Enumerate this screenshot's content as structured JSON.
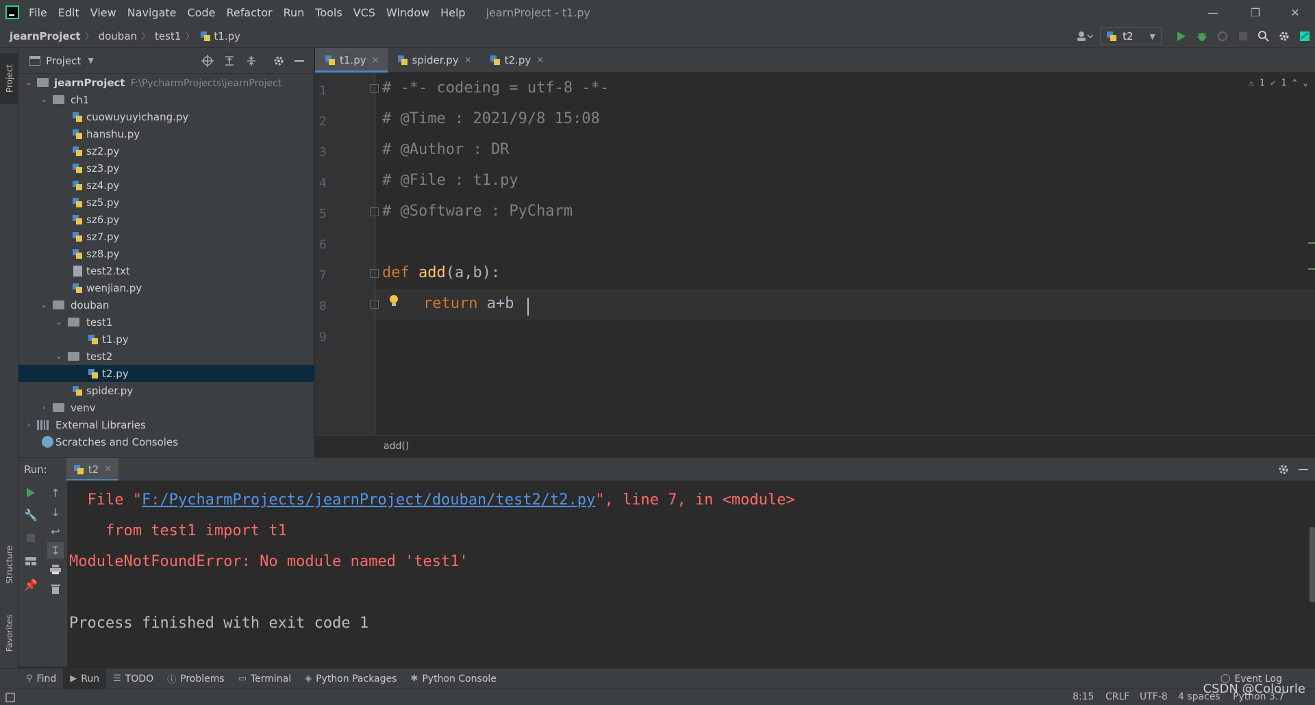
{
  "menu": {
    "items": [
      "File",
      "Edit",
      "View",
      "Navigate",
      "Code",
      "Refactor",
      "Run",
      "Tools",
      "VCS",
      "Window",
      "Help"
    ],
    "window_title": "jearnProject - t1.py"
  },
  "navbar": {
    "crumbs": [
      "jearnProject",
      "douban",
      "test1",
      "t1.py"
    ],
    "run_config": "t2"
  },
  "left_strip": {
    "project": "Project",
    "structure": "Structure",
    "favorites": "Favorites"
  },
  "project_panel": {
    "title": "Project",
    "root_name": "jearnProject",
    "root_path": "F:\\PycharmProjects\\jearnProject",
    "ch1": "ch1",
    "ch1_files": [
      "cuowuyuyichang.py",
      "hanshu.py",
      "sz2.py",
      "sz3.py",
      "sz4.py",
      "sz5.py",
      "sz6.py",
      "sz7.py",
      "sz8.py",
      "test2.txt",
      "wenjian.py"
    ],
    "douban": "douban",
    "test1": "test1",
    "t1": "t1.py",
    "test2": "test2",
    "t2": "t2.py",
    "spider": "spider.py",
    "venv": "venv",
    "ext_libs": "External Libraries",
    "scratches": "Scratches and Consoles"
  },
  "editor": {
    "tabs": [
      "t1.py",
      "spider.py",
      "t2.py"
    ],
    "line_numbers": [
      "1",
      "2",
      "3",
      "4",
      "5",
      "6",
      "7",
      "8",
      "9"
    ],
    "lines": {
      "l1": "# -*- codeing = utf-8 -*-",
      "l2": "# @Time : 2021/9/8 15:08",
      "l3": "# @Author : DR",
      "l4": "# @File : t1.py",
      "l5": "# @Software : PyCharm",
      "l7_kw": "def",
      "l7_fn": "add",
      "l7_rest": "(a,b):",
      "l8_kw": "return",
      "l8_rest": "a+b"
    },
    "warnings": "1",
    "weak_warnings": "1",
    "breadcrumb": "add()"
  },
  "run": {
    "label": "Run:",
    "tab": "t2",
    "console": {
      "line1_pre": "  File \"",
      "line1_link": "F:/PycharmProjects/jearnProject/douban/test2/t2.py",
      "line1_post": "\", line 7, in <module>",
      "line2": "    from test1 import t1",
      "line3": "ModuleNotFoundError: No module named 'test1'",
      "line4": "Process finished with exit code 1"
    }
  },
  "tool_windows": [
    "Find",
    "Run",
    "TODO",
    "Problems",
    "Terminal",
    "Python Packages",
    "Python Console"
  ],
  "event_log": "Event Log",
  "status": {
    "position": "8:15",
    "line_sep": "CRLF",
    "encoding": "UTF-8",
    "indent": "4 spaces",
    "interpreter": "Python 3.7"
  },
  "watermark": "CSDN @Colourle",
  "colors": {
    "background": "#2b2b2b",
    "panel": "#3c3f41",
    "comment": "#808080",
    "keyword": "#cc7832",
    "function": "#ffc66d",
    "error": "#ff6b68",
    "link": "#5394ec",
    "selection": "#0d293e"
  }
}
